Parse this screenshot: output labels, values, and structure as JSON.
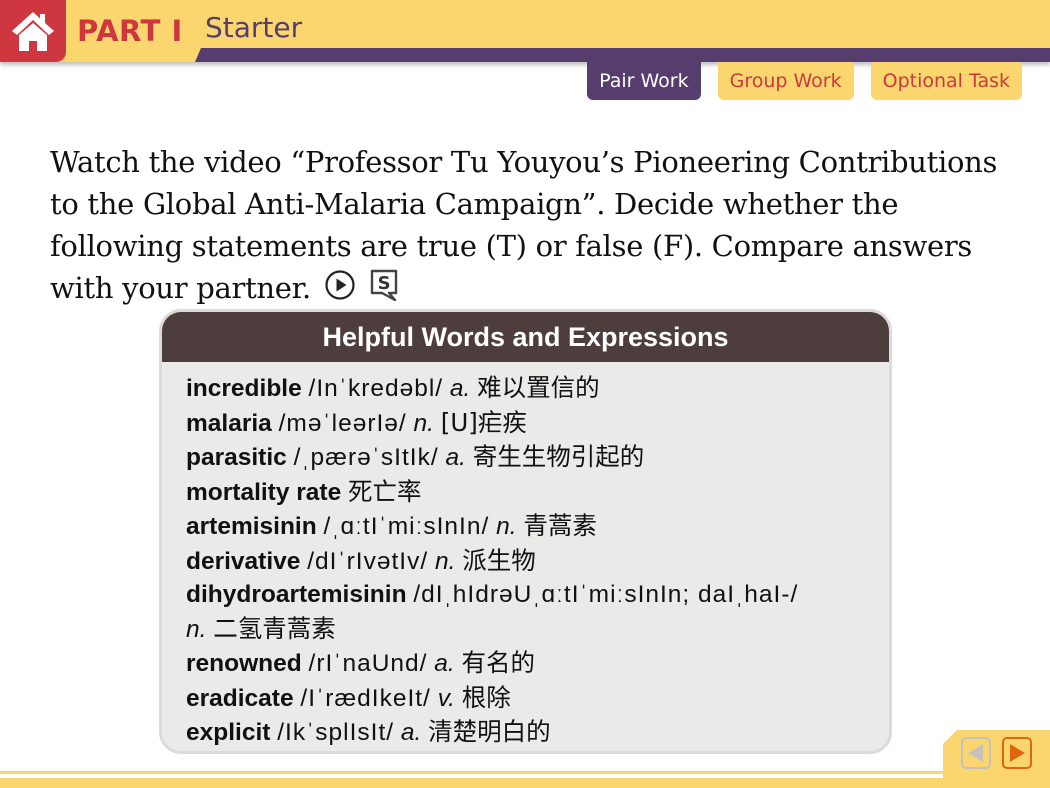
{
  "header": {
    "home_icon": "home-icon",
    "part_label": "PART I",
    "section_title": "Starter"
  },
  "tabs": [
    {
      "label": "Pair Work",
      "active": true
    },
    {
      "label": "Group Work",
      "active": false
    },
    {
      "label": "Optional Task",
      "active": false
    }
  ],
  "instructions": {
    "text": "Watch the video “Professor Tu Youyou’s Pioneering Contributions to the Global Anti-Malaria Campaign”. Decide whether the following statements are true (T) or false (F). Compare answers with your partner.",
    "play_icon": "play-circle-icon",
    "script_icon": "script-s-icon"
  },
  "card": {
    "title": "Helpful Words and Expressions",
    "entries": [
      {
        "word": "incredible",
        "phonetic": "/Inˈkredəbl/",
        "pos": "a.",
        "meaning": "难以置信的"
      },
      {
        "word": "malaria",
        "phonetic": "/məˈleərIə/",
        "pos": "n.",
        "meaning": "[U]疟疾"
      },
      {
        "word": "parasitic",
        "phonetic": "/ˌpærəˈsItIk/",
        "pos": "a.",
        "meaning": "寄生生物引起的"
      },
      {
        "word": "mortality rate",
        "phonetic": "",
        "pos": "",
        "meaning": "死亡率"
      },
      {
        "word": "artemisinin",
        "phonetic": "/ˌɑːtIˈmiːsInIn/",
        "pos": "n.",
        "meaning": "青蒿素"
      },
      {
        "word": "derivative",
        "phonetic": "/dIˈrIvətIv/",
        "pos": "n.",
        "meaning": "派生物"
      },
      {
        "word": "dihydroartemisinin",
        "phonetic": "/dIˌhIdrəUˌɑːtIˈmiːsInIn; daIˌhaI-/",
        "pos": "n.",
        "meaning": "二氢青蒿素",
        "wrap": true
      },
      {
        "word": "renowned",
        "phonetic": "/rIˈnaUnd/",
        "pos": "a.",
        "meaning": "有名的"
      },
      {
        "word": "eradicate",
        "phonetic": "/IˈrædIkeIt/",
        "pos": "v.",
        "meaning": "根除"
      },
      {
        "word": "explicit",
        "phonetic": "/IkˈsplIsIt/",
        "pos": "a.",
        "meaning": "清楚明白的"
      }
    ]
  },
  "nav": {
    "prev_icon": "previous-arrow-icon",
    "next_icon": "next-arrow-icon"
  },
  "colors": {
    "accent_yellow": "#fbd66e",
    "accent_purple": "#563d6e",
    "accent_red": "#cf3740",
    "card_header": "#4e3d3d",
    "next_orange": "#e0660e"
  }
}
